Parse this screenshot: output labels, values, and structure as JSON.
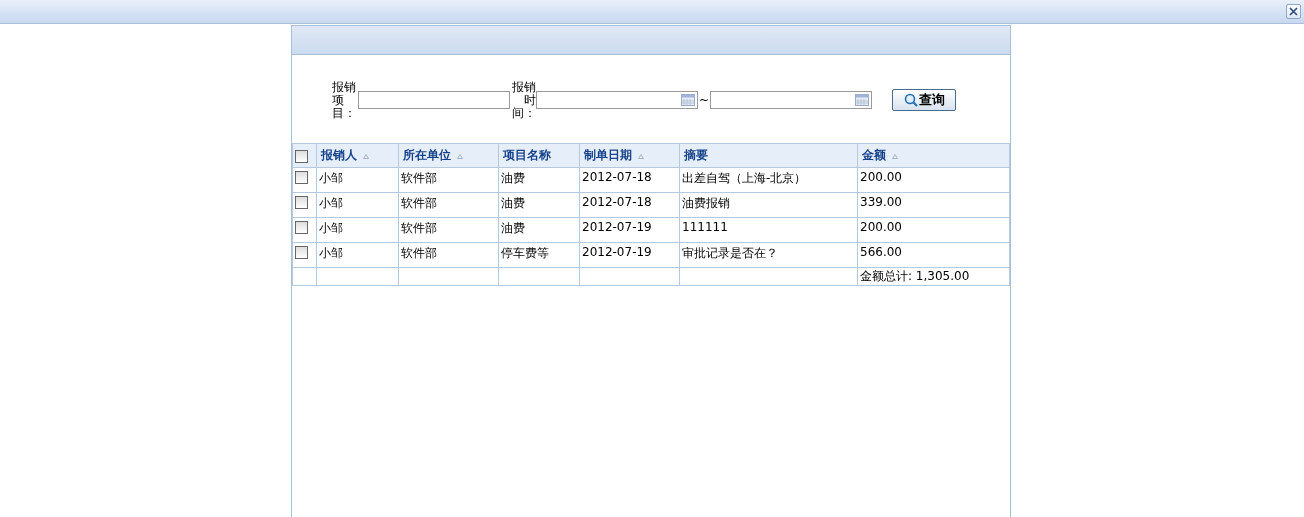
{
  "filters": [
    {
      "label": "报销项目：",
      "kind": "text"
    },
    {
      "label": "报销时间：",
      "kind": "daterange",
      "separator": "~"
    }
  ],
  "search_button": {
    "label": "查询"
  },
  "table": {
    "all_checked": false,
    "columns": [
      {
        "label": "报销人",
        "sortable": true
      },
      {
        "label": "所在单位",
        "sortable": true
      },
      {
        "label": "项目名称",
        "sortable": false
      },
      {
        "label": "制单日期",
        "sortable": true
      },
      {
        "label": "摘要",
        "sortable": false
      },
      {
        "label": "金额",
        "sortable": true
      }
    ],
    "rows": [
      {
        "checked": false,
        "cells": [
          "小邹",
          "软件部",
          "油费",
          "2012-07-18",
          "出差自驾（上海-北京）",
          "200.00"
        ]
      },
      {
        "checked": false,
        "cells": [
          "小邹",
          "软件部",
          "油费",
          "2012-07-18",
          "油费报销",
          "339.00"
        ]
      },
      {
        "checked": false,
        "cells": [
          "小邹",
          "软件部",
          "油费",
          "2012-07-19",
          "111111",
          "200.00"
        ]
      },
      {
        "checked": false,
        "cells": [
          "小邹",
          "软件部",
          "停车费等",
          "2012-07-19",
          "审批记录是否在？",
          "566.00"
        ]
      }
    ],
    "total": "金额总计: 1,305.00"
  }
}
